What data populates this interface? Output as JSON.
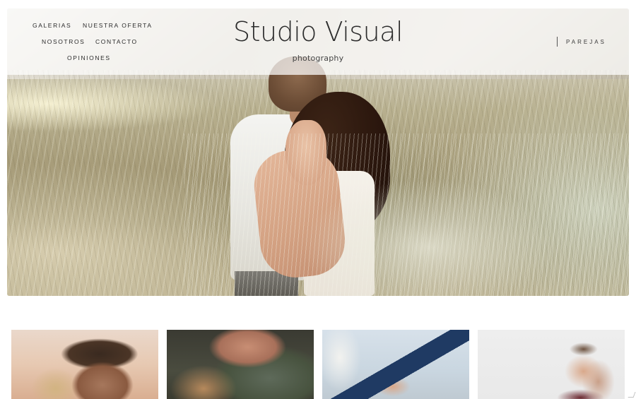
{
  "brand": {
    "title": "Studio Visual",
    "subtitle": "photography"
  },
  "nav": {
    "items": [
      {
        "label": "GALERIAS"
      },
      {
        "label": "NUESTRA OFERTA"
      },
      {
        "label": "NOSOTROS"
      },
      {
        "label": "CONTACTO"
      },
      {
        "label": "OPINIONES"
      }
    ]
  },
  "header_right": {
    "label": "PAREJAS"
  },
  "hero": {
    "image_icon": "couple-photo"
  },
  "thumbnails": [
    {
      "icon": "portrait-couple-photo"
    },
    {
      "icon": "hands-ring-photo"
    },
    {
      "icon": "holding-hands-photo"
    },
    {
      "icon": "couple-portrait-photo"
    }
  ],
  "colors": {
    "text": "#2b2b2b",
    "header_overlay": "#ffffff",
    "background": "#ffffff"
  }
}
